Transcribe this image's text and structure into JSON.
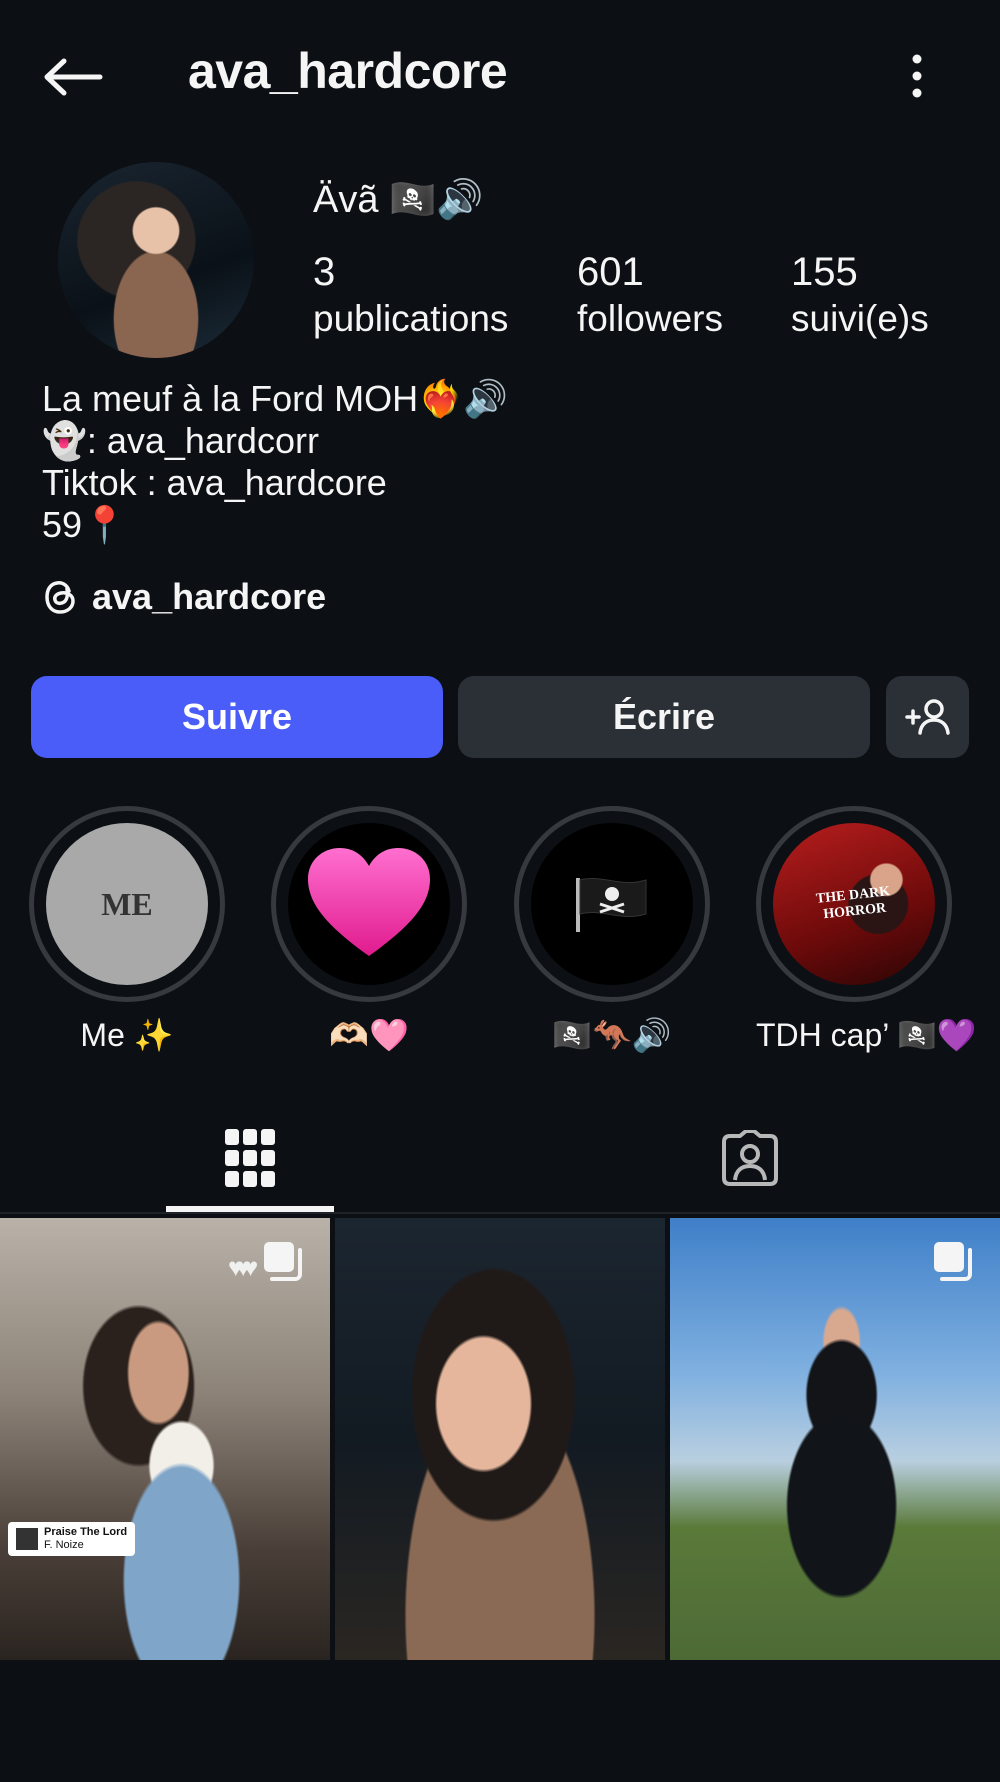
{
  "header": {
    "username": "ava_hardcore"
  },
  "profile": {
    "display_name": "Ävã 🏴‍☠️🔊",
    "stats": [
      {
        "value": "3",
        "label": "publications"
      },
      {
        "value": "601",
        "label": "followers"
      },
      {
        "value": "155",
        "label": "suivi(e)s"
      }
    ],
    "bio": [
      "La meuf à la Ford MOH❤️‍🔥🔊",
      "👻: ava_hardcorr",
      "Tiktok : ava_hardcore",
      "59📍"
    ],
    "threads_handle": "ava_hardcore"
  },
  "actions": {
    "follow_label": "Suivre",
    "message_label": "Écrire"
  },
  "highlights": [
    {
      "label": "Me ✨",
      "cover_text": "ME"
    },
    {
      "label": "🫶🏻🩷",
      "cover_text": "💗"
    },
    {
      "label": "🏴‍☠️🦘🔊",
      "cover_text": "🏴‍☠️"
    },
    {
      "label": "TDH cap’ 🏴‍☠️💜",
      "cover_text": "THE DARK HORROR"
    }
  ],
  "tabs": [
    {
      "name": "grid",
      "icon": "grid-icon",
      "active": true
    },
    {
      "name": "tagged",
      "icon": "tagged-icon",
      "active": false
    }
  ],
  "posts": [
    {
      "music_title": "Praise The Lord",
      "music_artist": "F. Noize",
      "badge": "carousel-icon"
    },
    {},
    {
      "badge": "carousel-icon"
    }
  ],
  "colors": {
    "background": "#0c1014",
    "primary_button": "#4a5df9",
    "secondary_button": "#2b3036"
  }
}
